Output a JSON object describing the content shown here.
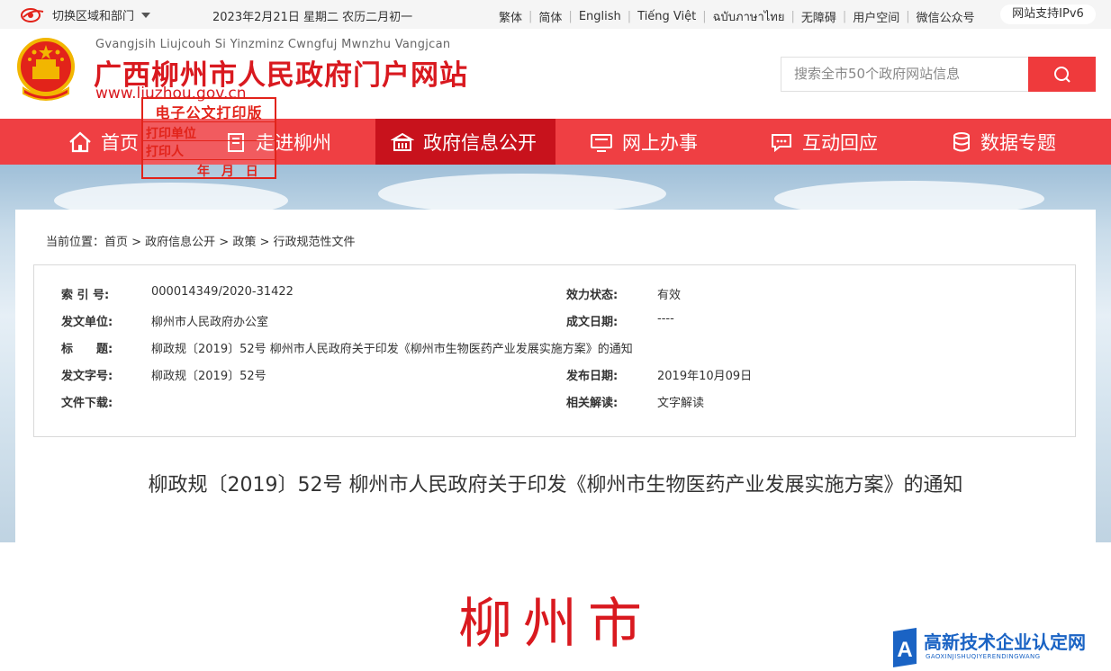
{
  "topbar": {
    "region_label": "切换区域和部门",
    "date": "2023年2月21日 星期二 农历二月初一",
    "links": [
      "繁体",
      "简体",
      "English",
      "Tiếng Việt",
      "ฉบับภาษาไทย",
      "无障碍",
      "用户空间",
      "微信公众号"
    ],
    "ipv6": "网站支持IPv6"
  },
  "header": {
    "pinyin": "Gvangjsih Liujcouh Si Yinzminz Cwngfuj Mwnzhu Vangjcan",
    "title": "广西柳州市人民政府门户网站",
    "url": "www.liuzhou.gov.cn",
    "search_placeholder": "搜索全市50个政府网站信息"
  },
  "nav": {
    "items": [
      {
        "label": "首页",
        "icon": "home-icon"
      },
      {
        "label": "走进柳州",
        "icon": "building-icon"
      },
      {
        "label": "政府信息公开",
        "icon": "gov-building-icon"
      },
      {
        "label": "网上办事",
        "icon": "monitor-icon"
      },
      {
        "label": "互动回应",
        "icon": "chat-icon"
      },
      {
        "label": "数据专题",
        "icon": "database-icon"
      }
    ],
    "active_index": 2
  },
  "breadcrumb": "当前位置：首页 > 政府信息公开 > 政策 > 行政规范性文件",
  "meta": {
    "index_label": "索 引 号:",
    "index_value": "000014349/2020-31422",
    "status_label": "效力状态:",
    "status_value": "有效",
    "issuer_label": "发文单位:",
    "issuer_value": "柳州市人民政府办公室",
    "created_label": "成文日期:",
    "created_value": "----",
    "title_label": "标　　题:",
    "title_value": "柳政规〔2019〕52号 柳州市人民政府关于印发《柳州市生物医药产业发展实施方案》的通知",
    "docno_label": "发文字号:",
    "docno_value": "柳政规〔2019〕52号",
    "published_label": "发布日期:",
    "published_value": "2019年10月09日",
    "download_label": "文件下载:",
    "interpret_label": "相关解读:",
    "interpret_value": "文字解读"
  },
  "document": {
    "title": "柳政规〔2019〕52号 柳州市人民政府关于印发《柳州市生物医药产业发展实施方案》的通知",
    "heading": "柳州市"
  },
  "stamp": {
    "title": "电子公文打印版",
    "unit_label": "打印单位",
    "person_label": "打印人",
    "date_text": "年 月 日"
  },
  "watermark": {
    "text": "高新技术企业认定网",
    "sub": "GAOXINJISHUQIYERENDINGWANG"
  },
  "colors": {
    "brand_red": "#ef3f43",
    "nav_active": "#c8121c",
    "title_red": "#d9191f"
  }
}
